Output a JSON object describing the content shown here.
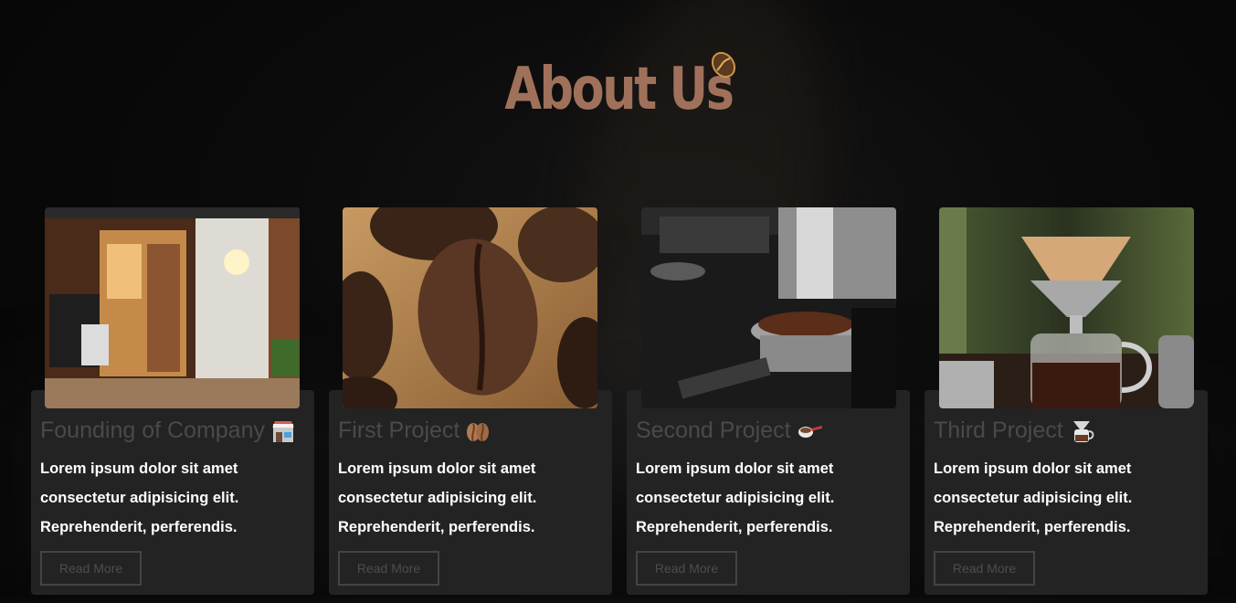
{
  "section": {
    "title": "About Us"
  },
  "cards": [
    {
      "title": "Founding of Company",
      "emoji": "store-icon",
      "text_lines": [
        "Lorem ipsum dolor sit amet",
        "consectetur adipisicing elit.",
        "Reprehenderit, perferendis."
      ],
      "button": "Read More"
    },
    {
      "title": "First Project",
      "emoji": "coffee-bean-icon",
      "text_lines": [
        "Lorem ipsum dolor sit amet",
        "consectetur adipisicing elit.",
        "Reprehenderit, perferendis."
      ],
      "button": "Read More"
    },
    {
      "title": "Second Project",
      "emoji": "coffee-scoop-icon",
      "text_lines": [
        "Lorem ipsum dolor sit amet",
        "consectetur adipisicing elit.",
        "Reprehenderit, perferendis."
      ],
      "button": "Read More"
    },
    {
      "title": "Third Project",
      "emoji": "coffee-pot-icon",
      "text_lines": [
        "Lorem ipsum dolor sit amet",
        "consectetur adipisicing elit.",
        "Reprehenderit, perferendis."
      ],
      "button": "Read More"
    }
  ],
  "colors": {
    "accent": "#a0715a",
    "card_bg": "#232323",
    "muted_text": "#4a4a4a"
  }
}
